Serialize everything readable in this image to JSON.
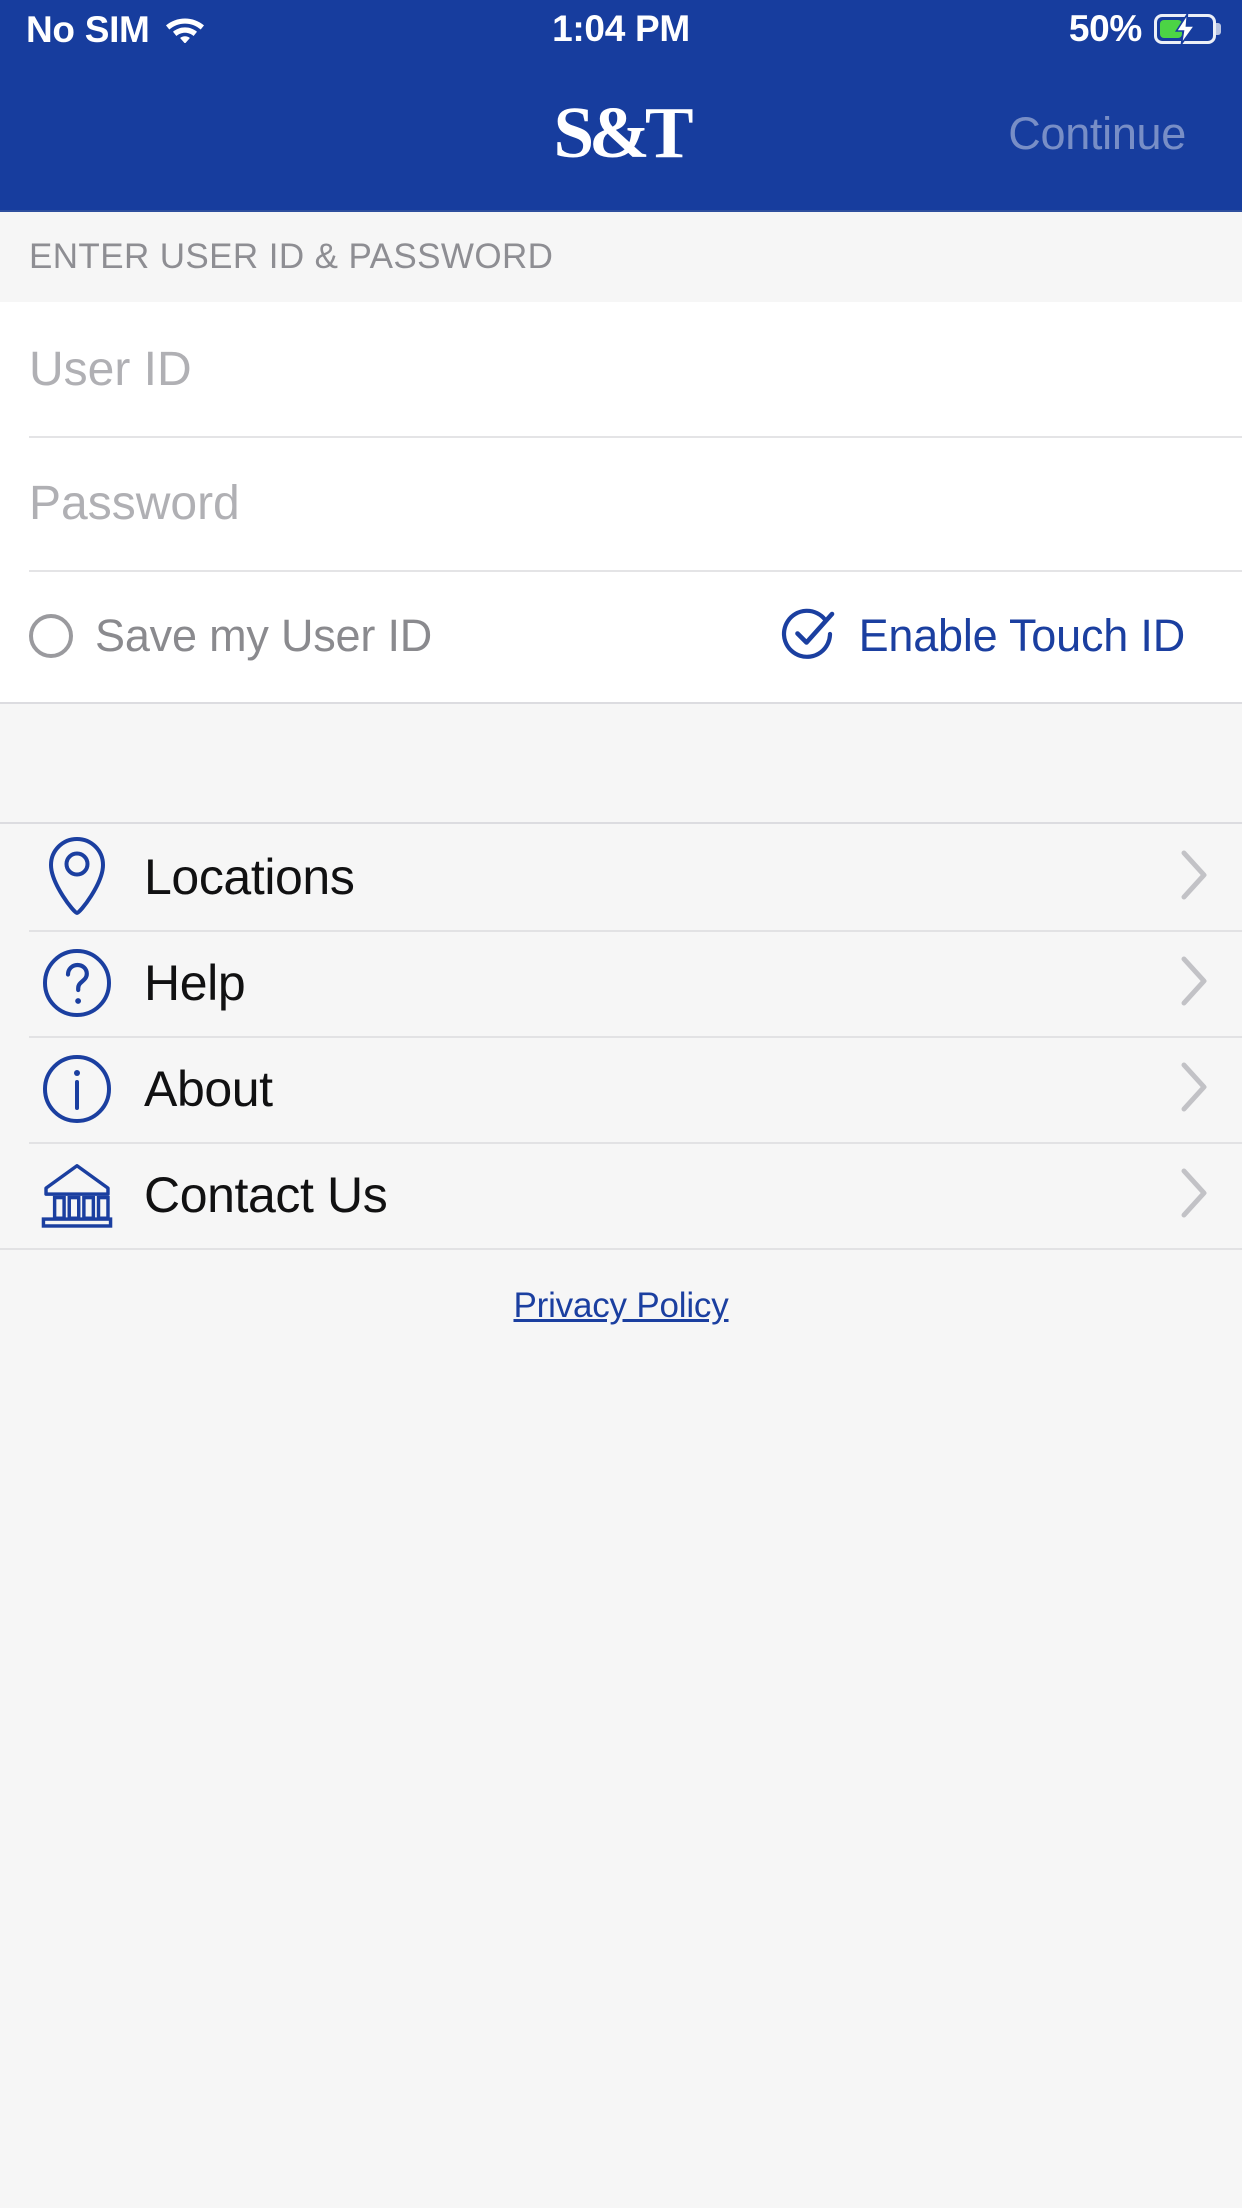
{
  "status_bar": {
    "carrier": "No SIM",
    "wifi_icon": "wifi-icon",
    "time": "1:04 PM",
    "battery_percent_label": "50%",
    "battery_level": 50,
    "battery_charging": true,
    "battery_icon": "battery-charging-icon"
  },
  "nav_bar": {
    "logo_text": "S&T",
    "action_label": "Continue",
    "action_enabled": false
  },
  "form": {
    "section_header": "ENTER USER ID & PASSWORD",
    "user_id": {
      "value": "",
      "placeholder": "User ID"
    },
    "password": {
      "value": "",
      "placeholder": "Password"
    },
    "save_user_id": {
      "label": "Save my User ID",
      "checked": false,
      "icon": "radio-unchecked-icon"
    },
    "touch_id": {
      "label": "Enable Touch ID",
      "checked": true,
      "icon": "check-circle-icon"
    }
  },
  "menu": {
    "items": [
      {
        "label": "Locations",
        "icon": "map-pin-icon",
        "chevron": "chevron-right-icon"
      },
      {
        "label": "Help",
        "icon": "question-circle-icon",
        "chevron": "chevron-right-icon"
      },
      {
        "label": "About",
        "icon": "info-circle-icon",
        "chevron": "chevron-right-icon"
      },
      {
        "label": "Contact Us",
        "icon": "bank-building-icon",
        "chevron": "chevron-right-icon"
      }
    ]
  },
  "footer": {
    "privacy_policy": "Privacy Policy"
  },
  "colors": {
    "brand_blue": "#173D9E",
    "accent_blue": "#1B3FA0",
    "page_background": "#f6f6f6",
    "card_background": "#ffffff",
    "battery_green": "#4CD445",
    "placeholder_gray": "#b0b0b4",
    "muted_gray": "#8e8e93"
  }
}
